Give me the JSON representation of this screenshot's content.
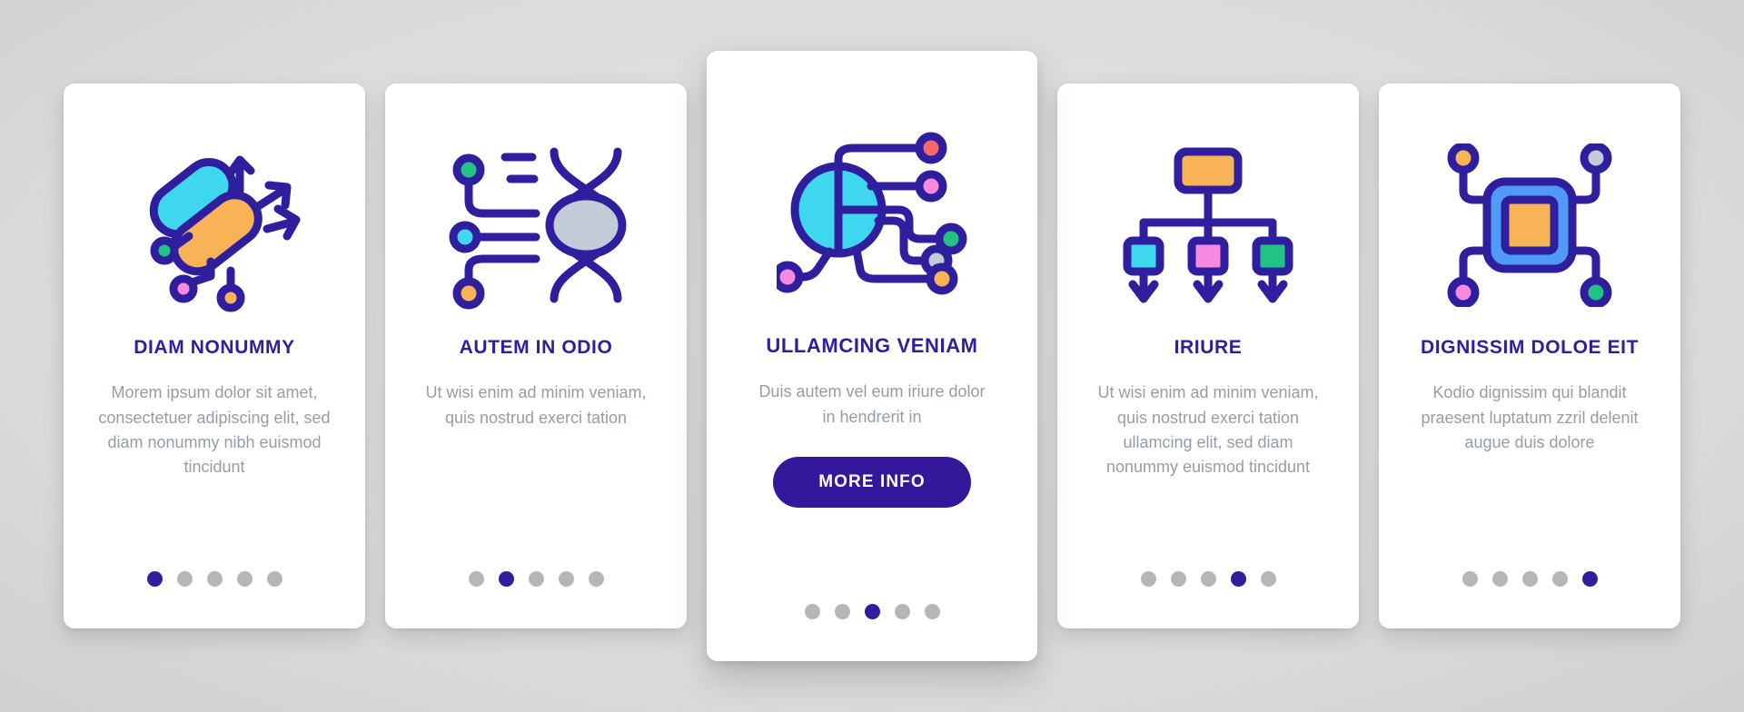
{
  "theme": {
    "background": "#d6d6d6",
    "card_background": "#ffffff",
    "title_color": "#2f1f9e",
    "body_color": "#949da8",
    "accent": "#33189b",
    "dot_inactive": "#b6b6b6",
    "dot_active": "#2f1f9e",
    "icon_stroke": "#2f1f9e",
    "icon_cyan": "#3fd6f0",
    "icon_orange": "#f8b356",
    "icon_pink": "#f58ae0",
    "icon_green": "#21c383",
    "icon_gray": "#c2cbd8",
    "icon_blue": "#4f9bf5",
    "icon_red": "#f2686b"
  },
  "cards": [
    {
      "id": "card-1",
      "featured": false,
      "icon_name": "neural-network-arrows-icon",
      "title": "DIAM NONUMMY",
      "body": "Morem ipsum dolor sit amet, consectetuer adipiscing elit, sed diam nonummy nibh euismod tincidunt",
      "has_button": false,
      "button_label": "",
      "dots_total": 5,
      "dot_active_index": 0
    },
    {
      "id": "card-2",
      "featured": false,
      "icon_name": "dna-helix-circuit-icon",
      "title": "AUTEM IN ODIO",
      "body": "Ut wisi enim ad minim veniam, quis nostrud exerci tation",
      "has_button": false,
      "button_label": "",
      "dots_total": 5,
      "dot_active_index": 1
    },
    {
      "id": "card-3",
      "featured": true,
      "icon_name": "network-node-hub-icon",
      "title": "ULLAMCING VENIAM",
      "body": "Duis autem vel eum iriure dolor in hendrerit in",
      "has_button": true,
      "button_label": "MORE INFO",
      "dots_total": 5,
      "dot_active_index": 2
    },
    {
      "id": "card-4",
      "featured": false,
      "icon_name": "hierarchy-tree-arrows-icon",
      "title": "IRIURE",
      "body": "Ut wisi enim ad minim veniam, quis nostrud exerci tation ullamcing elit, sed diam nonummy euismod tincidunt",
      "has_button": false,
      "button_label": "",
      "dots_total": 5,
      "dot_active_index": 3
    },
    {
      "id": "card-5",
      "featured": false,
      "icon_name": "processor-chip-icon",
      "title": "DIGNISSIM DOLOE EIT",
      "body": "Kodio dignissim qui blandit praesent luptatum zzril delenit augue duis dolore",
      "has_button": false,
      "button_label": "",
      "dots_total": 5,
      "dot_active_index": 4
    }
  ]
}
